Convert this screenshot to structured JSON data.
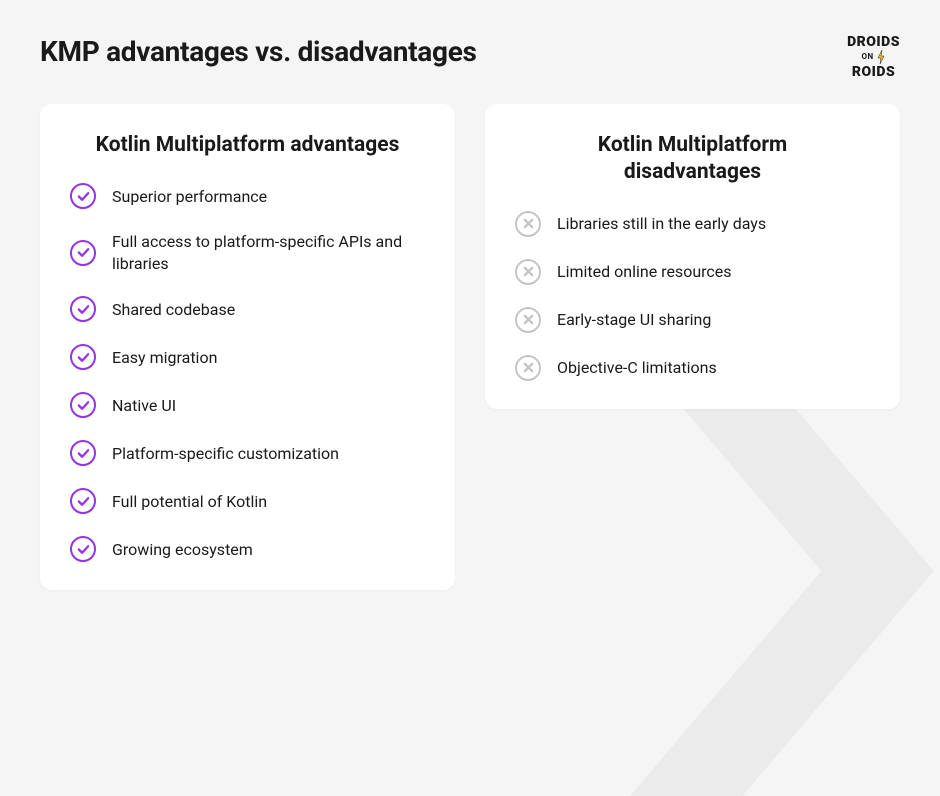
{
  "title": "KMP advantages vs. disadvantages",
  "logo": {
    "top": "DROIDS",
    "middle": "ON",
    "bottom": "ROIDS"
  },
  "advantages": {
    "heading": "Kotlin Multiplatform advantages",
    "items": [
      "Superior performance",
      "Full access to platform-specific APIs and libraries",
      "Shared codebase",
      "Easy migration",
      "Native UI",
      "Platform-specific customization",
      "Full potential of Kotlin",
      "Growing ecosystem"
    ]
  },
  "disadvantages": {
    "heading": "Kotlin Multiplatform disadvantages",
    "items": [
      "Libraries still in the early days",
      "Limited online resources",
      "Early-stage UI sharing",
      "Objective-C limitations"
    ]
  },
  "colors": {
    "accent": "#9333ea",
    "muted": "#c4c4c4"
  }
}
